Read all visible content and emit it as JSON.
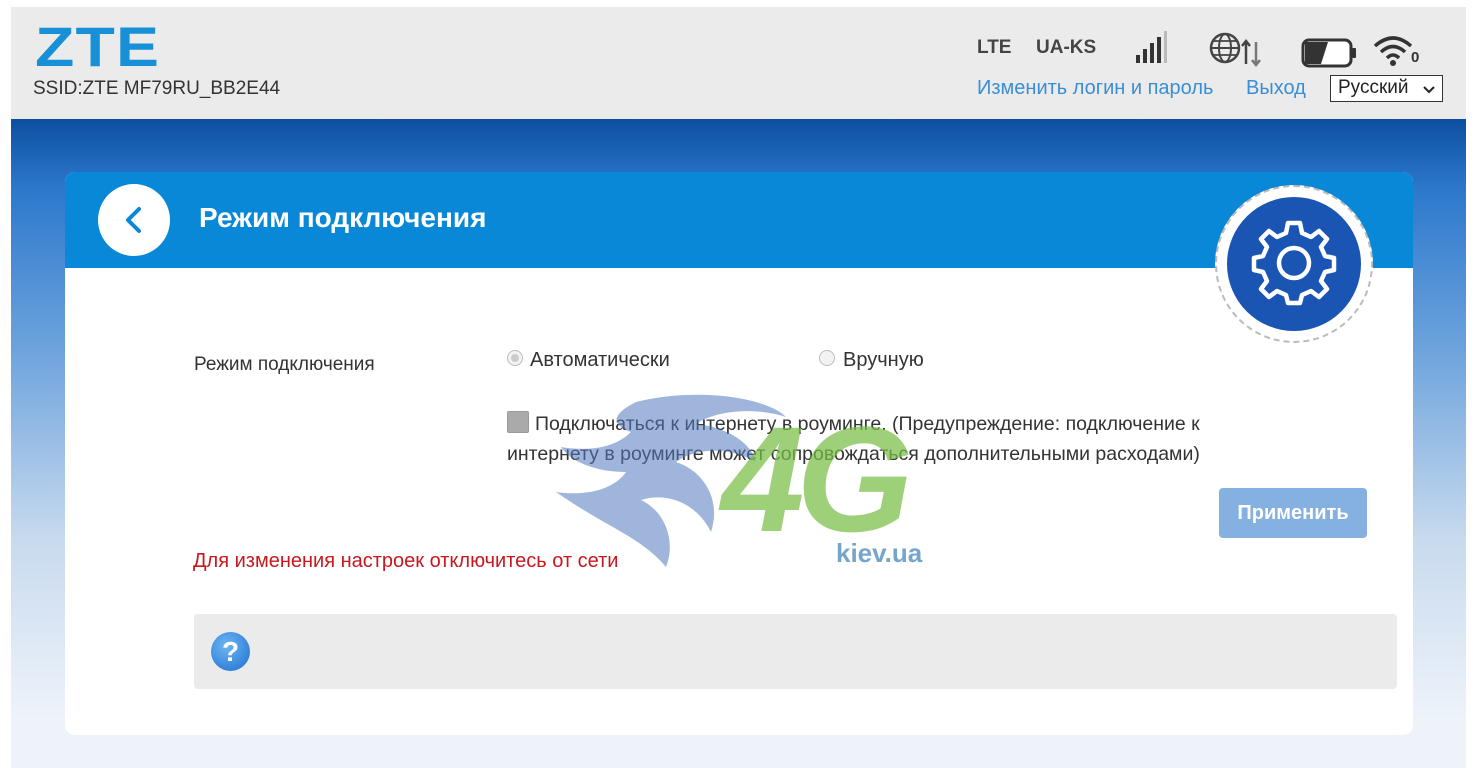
{
  "header": {
    "logo": "ZTE",
    "ssid": "SSID:ZTE MF79RU_BB2E44",
    "network_type": "LTE",
    "operator": "UA-KS",
    "icons": {
      "signal": "signal-bars-icon",
      "network": "globe-data-icon",
      "battery": "battery-icon",
      "wifi": "wifi-icon",
      "wifi_clients": "0"
    },
    "change_login_link": "Изменить логин и пароль",
    "logout_link": "Выход",
    "language_selected": "Русский"
  },
  "page": {
    "title": "Режим подключения",
    "back_icon": "chevron-left-icon",
    "settings_icon": "gear-icon"
  },
  "form": {
    "mode_label": "Режим подключения",
    "option_auto": "Автоматически",
    "option_manual": "Вручную",
    "selected_option": "Автоматически",
    "roaming_text": "Подключаться к интернету в роуминге. (Предупреждение: подключение к интернету в роуминге может сопровождаться дополнительными расходами)",
    "roaming_checked": false,
    "apply_button": "Применить",
    "warning": "Для изменения настроек отключитесь от сети"
  },
  "help": {
    "icon_label": "?"
  },
  "watermark": {
    "logo_text": "4G",
    "site": "kiev.ua"
  },
  "colors": {
    "accent": "#0a88d8",
    "link": "#3a8ed6",
    "warning": "#c8181e",
    "gear_bg": "#1b55b3"
  }
}
